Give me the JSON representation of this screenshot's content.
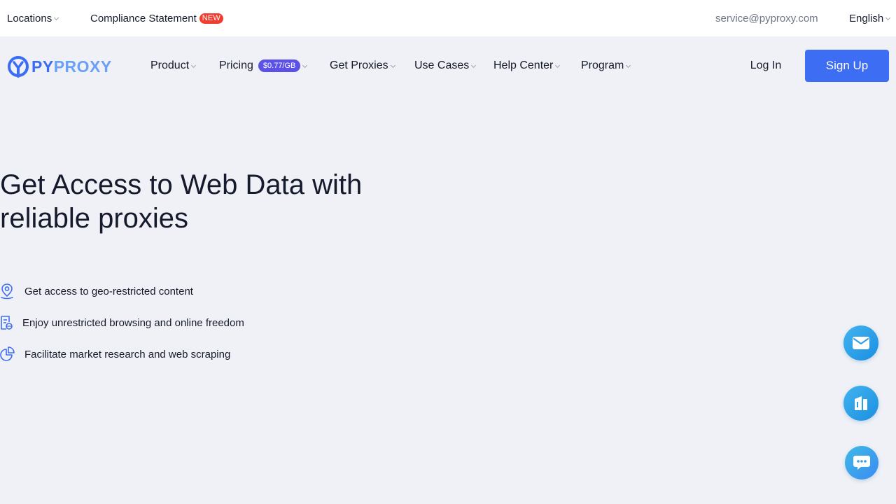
{
  "topbar": {
    "locations_label": "Locations",
    "compliance_label": "Compliance Statement",
    "new_badge": "NEW",
    "email": "service@pyproxy.com",
    "language": "English"
  },
  "logo": {
    "py": "PY",
    "proxy": "PROXY"
  },
  "nav": {
    "product": "Product",
    "pricing": "Pricing",
    "pricing_badge": "$0.77/GB",
    "get_proxies": "Get Proxies",
    "use_cases": "Use Cases",
    "help_center": "Help Center",
    "program": "Program",
    "login": "Log In",
    "signup": "Sign Up"
  },
  "hero": {
    "title_line1": "Get Access to Web Data with",
    "title_line2": "reliable proxies"
  },
  "features": [
    {
      "icon": "location-pin-icon",
      "text": "Get access to geo-restricted content"
    },
    {
      "icon": "document-globe-icon",
      "text": "Enjoy unrestricted browsing and online freedom"
    },
    {
      "icon": "pie-chart-icon",
      "text": "Facilitate market research and web scraping"
    }
  ],
  "floating_buttons": [
    {
      "icon": "mail-icon"
    },
    {
      "icon": "document-icon"
    },
    {
      "icon": "chat-bubble-icon"
    }
  ],
  "colors": {
    "accent": "#3d6df3",
    "pricing_badge": "#5b51e4",
    "new_badge": "#f23c2e",
    "background": "#f0f1f6"
  }
}
